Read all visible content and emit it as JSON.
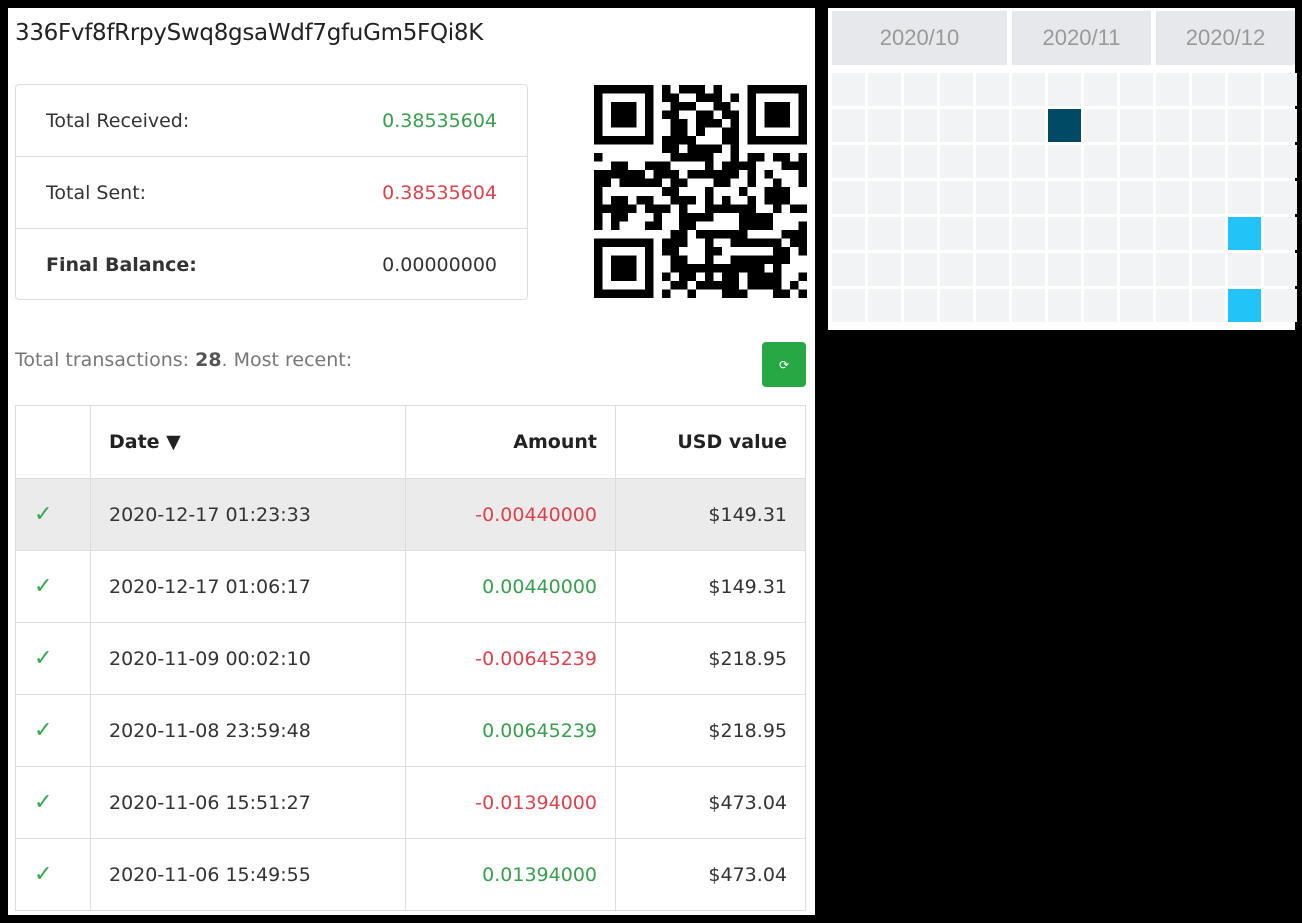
{
  "address": "336Fvf8fRrpySwq8gsaWdf7gfuGm5FQi8K",
  "summary": {
    "received_label": "Total Received:",
    "received_value": "0.38535604",
    "sent_label": "Total Sent:",
    "sent_value": "0.38535604",
    "balance_label": "Final Balance:",
    "balance_value": "0.00000000"
  },
  "tx_info": {
    "prefix": "Total transactions: ",
    "count": "28",
    "suffix": ". Most recent:"
  },
  "refresh_icon": "⟳",
  "table": {
    "headers": [
      "",
      "Date ▼",
      "Amount",
      "USD value"
    ],
    "rows": [
      {
        "status": "✓",
        "date": "2020-12-17 01:23:33",
        "amount": "-0.00440000",
        "usd": "$149.31",
        "type": "out"
      },
      {
        "status": "✓",
        "date": "2020-12-17 01:06:17",
        "amount": "0.00440000",
        "usd": "$149.31",
        "type": "in"
      },
      {
        "status": "✓",
        "date": "2020-11-09 00:02:10",
        "amount": "-0.00645239",
        "usd": "$218.95",
        "type": "out"
      },
      {
        "status": "✓",
        "date": "2020-11-08 23:59:48",
        "amount": "0.00645239",
        "usd": "$218.95",
        "type": "in"
      },
      {
        "status": "✓",
        "date": "2020-11-06 15:51:27",
        "amount": "-0.01394000",
        "usd": "$473.04",
        "type": "out"
      },
      {
        "status": "✓",
        "date": "2020-11-06 15:49:55",
        "amount": "0.01394000",
        "usd": "$473.04",
        "type": "in"
      }
    ]
  },
  "calendar": {
    "months": [
      {
        "label": "2020/10",
        "weeks": 5
      },
      {
        "label": "2020/11",
        "weeks": 4
      },
      {
        "label": "2020/12",
        "weeks": 4
      }
    ],
    "days_per_week": 7,
    "active": [
      {
        "week": 6,
        "day": 1,
        "color": "#004a66"
      },
      {
        "week": 11,
        "day": 4,
        "color": "#22c4f7"
      },
      {
        "week": 11,
        "day": 6,
        "color": "#22c4f7"
      }
    ],
    "empty_color": "#f2f3f5"
  }
}
